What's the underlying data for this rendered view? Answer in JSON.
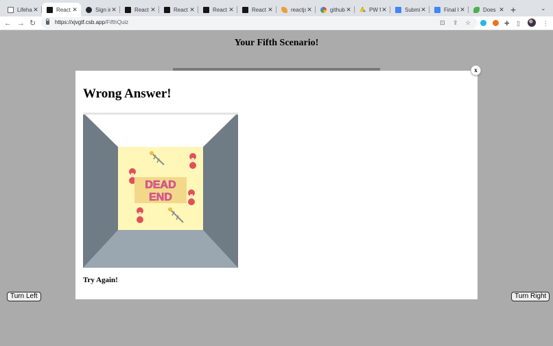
{
  "browser": {
    "tabs": [
      {
        "title": "Lifehac",
        "icon": "square-tab-icon",
        "active": false
      },
      {
        "title": "React",
        "icon": "codesandbox-icon",
        "active": true
      },
      {
        "title": "Sign in",
        "icon": "github-icon",
        "active": false
      },
      {
        "title": "React",
        "icon": "codesandbox-icon",
        "active": false
      },
      {
        "title": "React",
        "icon": "codesandbox-icon",
        "active": false
      },
      {
        "title": "React",
        "icon": "codesandbox-icon",
        "active": false
      },
      {
        "title": "React",
        "icon": "codesandbox-icon",
        "active": false
      },
      {
        "title": "reactjs",
        "icon": "reactjs-icon",
        "active": false
      },
      {
        "title": "github",
        "icon": "google-icon",
        "active": false
      },
      {
        "title": "PW fo",
        "icon": "drive-icon",
        "active": false
      },
      {
        "title": "Submi",
        "icon": "docs-icon",
        "active": false
      },
      {
        "title": "Final I",
        "icon": "docs-icon",
        "active": false
      },
      {
        "title": "Does",
        "icon": "dino-icon",
        "active": false
      }
    ],
    "close_glyph": "✕",
    "new_tab_glyph": "+",
    "url_host": "https://xjvgtf.csb.app",
    "url_path": "/FifthQuiz"
  },
  "page": {
    "title": "Your Fifth Scenario!",
    "turn_left_label": "Turn Left",
    "turn_right_label": "Turn Right"
  },
  "modal": {
    "close_label": "x",
    "heading": "Wrong Answer!",
    "image_text_line1": "DEAD",
    "image_text_line2": "END",
    "footer": "Try Again!"
  },
  "colors": {
    "page_background": "#ababab",
    "maze_wall": "#6f7c85",
    "maze_floor": "#9aa6b0",
    "maze_back_wall": "#fff7b8",
    "dead_end_text": "#e85a9a"
  }
}
